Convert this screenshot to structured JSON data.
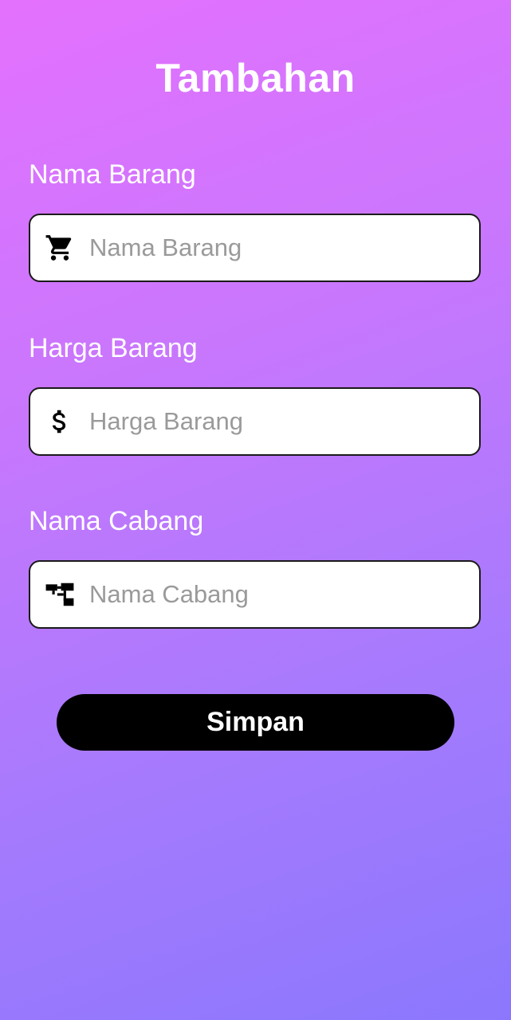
{
  "page": {
    "title": "Tambahan"
  },
  "form": {
    "fields": [
      {
        "label": "Nama Barang",
        "placeholder": "Nama Barang",
        "value": "",
        "icon": "shopping-cart-icon"
      },
      {
        "label": "Harga Barang",
        "placeholder": "Harga Barang",
        "value": "",
        "icon": "dollar-icon"
      },
      {
        "label": "Nama Cabang",
        "placeholder": "Nama Cabang",
        "value": "",
        "icon": "branch-tree-icon"
      }
    ],
    "save_label": "Simpan"
  },
  "colors": {
    "gradient_top": "#e471fe",
    "gradient_bottom": "#8b77fd",
    "button_bg": "#000000",
    "input_bg": "#ffffff",
    "placeholder": "#9a9a9a"
  }
}
